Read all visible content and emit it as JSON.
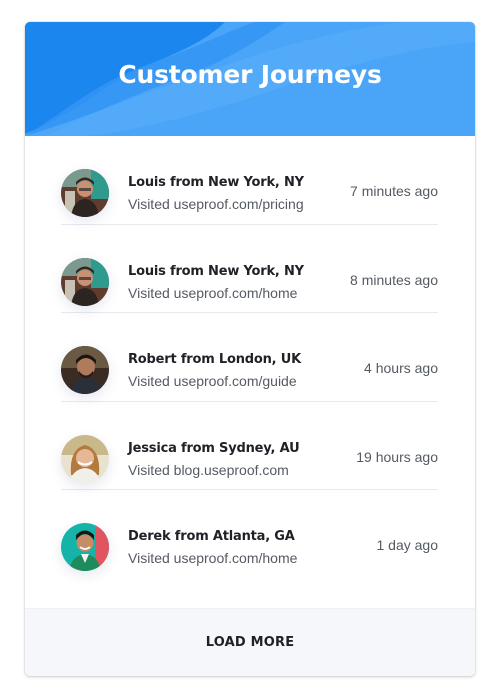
{
  "header": {
    "title": "Customer Journeys",
    "colors": {
      "primary": "#3b9bf7",
      "light": "#5db0fb",
      "dark": "#1583ee"
    }
  },
  "journeys": [
    {
      "name": "Louis from New York, NY",
      "visited": "Visited useproof.com/pricing",
      "time": "7 minutes ago",
      "avatar": "louis-avatar"
    },
    {
      "name": "Louis from New York, NY",
      "visited": "Visited useproof.com/home",
      "time": "8 minutes ago",
      "avatar": "louis-avatar"
    },
    {
      "name": "Robert from London, UK",
      "visited": "Visited useproof.com/guide",
      "time": "4 hours ago",
      "avatar": "robert-avatar"
    },
    {
      "name": "Jessica from Sydney, AU",
      "visited": "Visited blog.useproof.com",
      "time": "19 hours ago",
      "avatar": "jessica-avatar"
    },
    {
      "name": "Derek from Atlanta, GA",
      "visited": "Visited useproof.com/home",
      "time": "1 day ago",
      "avatar": "derek-avatar"
    }
  ],
  "footer": {
    "load_more_label": "LOAD MORE"
  }
}
